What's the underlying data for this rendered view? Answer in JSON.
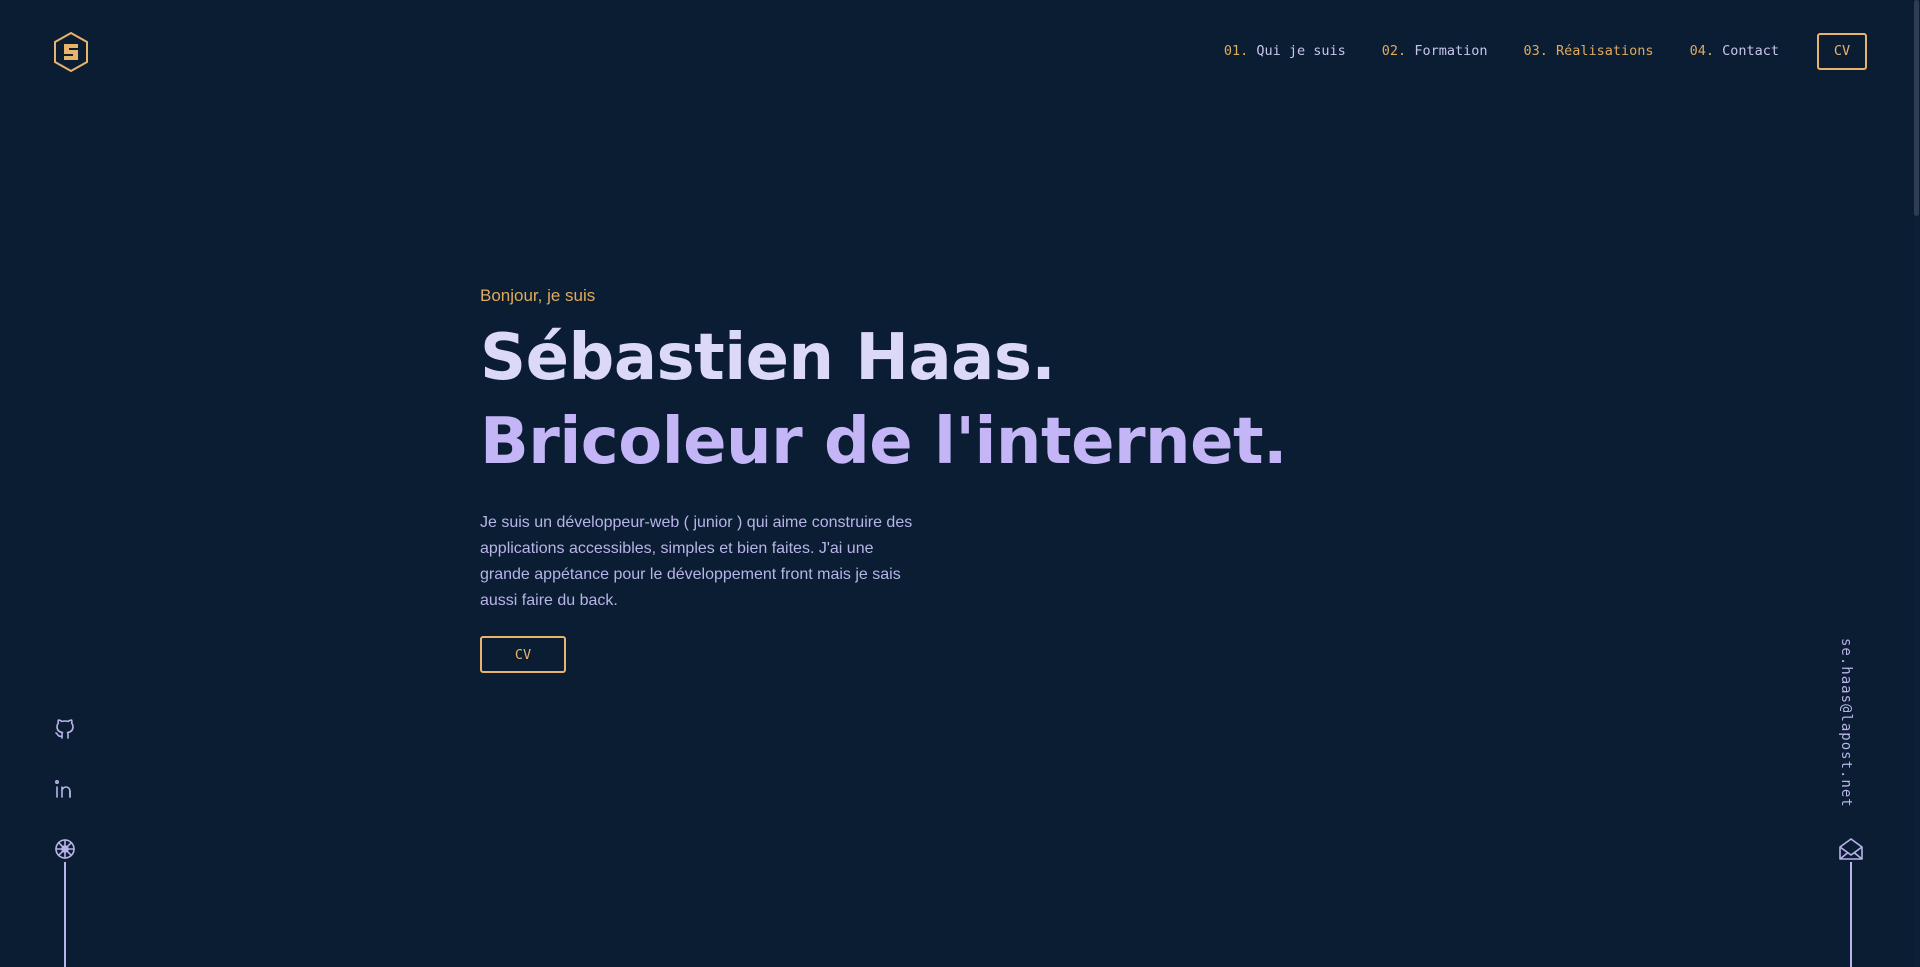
{
  "header": {
    "logo_icon": "hexagon-s-logo-icon",
    "logo_letter": "S",
    "nav": [
      {
        "num": "01.",
        "label": "Qui je suis"
      },
      {
        "num": "02.",
        "label": "Formation"
      },
      {
        "num": "03.",
        "label": "Réalisations"
      },
      {
        "num": "04.",
        "label": "Contact"
      }
    ],
    "cv_label": "CV"
  },
  "hero": {
    "greeting": "Bonjour, je suis",
    "name": "Sébastien Haas.",
    "tagline": "Bricoleur de l'internet.",
    "intro": "Je suis un développeur-web ( junior ) qui aime construire des applications accessibles, simples et bien faites. J'ai une grande appétance pour le développement front mais je sais aussi faire du back.",
    "cv_label": "CV"
  },
  "social": {
    "items": [
      {
        "icon": "github-icon"
      },
      {
        "icon": "linkedin-icon"
      },
      {
        "icon": "dribbble-icon"
      }
    ]
  },
  "contact": {
    "email": "se.haas@lapost.net",
    "icon": "mail-icon"
  },
  "colors": {
    "background": "#0a1d33",
    "accent": "#e0aa5c",
    "text_light": "#dcd8f8",
    "text_violet": "#c4b6f6",
    "text_body": "#b8b4e8"
  }
}
